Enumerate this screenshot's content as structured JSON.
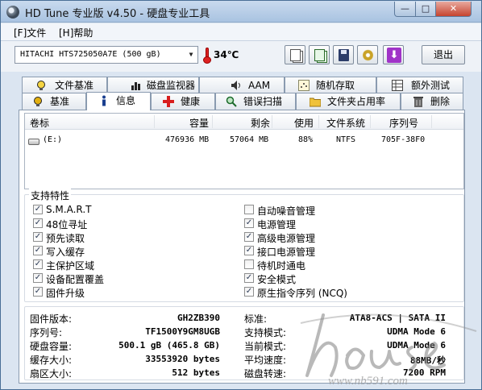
{
  "window": {
    "title": "HD Tune 专业版 v4.50 - 硬盘专业工具",
    "min": "—",
    "max": "□",
    "close": "✕"
  },
  "menu": {
    "file": "[F]文件",
    "help": "[H]帮助"
  },
  "toolbar": {
    "drive": "HITACHI HTS725050A7E   (500 gB)",
    "temperature": "34℃",
    "exit": "退出"
  },
  "tabs": {
    "row1": [
      "文件基准",
      "磁盘监视器",
      "AAM",
      "随机存取",
      "额外测试"
    ],
    "row2": [
      "基准",
      "信息",
      "健康",
      "错误扫描",
      "文件夹占用率",
      "删除"
    ]
  },
  "volumes": {
    "columns": [
      "卷标",
      "容量",
      "剩余",
      "使用",
      "文件系统",
      "序列号"
    ],
    "rows": [
      {
        "label": "(E:)",
        "capacity": "476936 MB",
        "free": "57064 MB",
        "used": "88%",
        "fs": "NTFS",
        "serial": "705F-38F0"
      }
    ]
  },
  "features": {
    "title": "支持特性",
    "left": [
      {
        "label": "S.M.A.R.T",
        "checked": true
      },
      {
        "label": "48位寻址",
        "checked": true
      },
      {
        "label": "预先读取",
        "checked": true
      },
      {
        "label": "写入缓存",
        "checked": true
      },
      {
        "label": "主保护区域",
        "checked": true
      },
      {
        "label": "设备配置覆盖",
        "checked": true
      },
      {
        "label": "固件升级",
        "checked": true
      }
    ],
    "right": [
      {
        "label": "自动噪音管理",
        "checked": false
      },
      {
        "label": "电源管理",
        "checked": true
      },
      {
        "label": "高级电源管理",
        "checked": true
      },
      {
        "label": "接口电源管理",
        "checked": true
      },
      {
        "label": "待机时通电",
        "checked": false
      },
      {
        "label": "安全模式",
        "checked": true
      },
      {
        "label": "原生指令序列 (NCQ)",
        "checked": true
      }
    ]
  },
  "info": {
    "left": [
      {
        "label": "固件版本:",
        "value": "GH2ZB390"
      },
      {
        "label": "序列号:",
        "value": "TF1500Y9GM8UGB"
      },
      {
        "label": "硬盘容量:",
        "value": "500.1 gB (465.8 GB)"
      },
      {
        "label": "缓存大小:",
        "value": "33553920 bytes"
      },
      {
        "label": "扇区大小:",
        "value": "512 bytes"
      }
    ],
    "right": [
      {
        "label": "标准:",
        "value": "ATA8-ACS | SATA II"
      },
      {
        "label": "支持模式:",
        "value": "UDMA Mode 6"
      },
      {
        "label": "当前模式:",
        "value": "UDMA Mode 6"
      },
      {
        "label": "平均速度:",
        "value": "88MB/秒"
      },
      {
        "label": "磁盘转速:",
        "value": "7200 RPM"
      }
    ]
  },
  "watermark": {
    "text": "www.nb591.com"
  },
  "colors": {
    "tab_health": "#d81e1e",
    "tab_bench": "#e3b010",
    "purple_button": "#a033c8"
  }
}
